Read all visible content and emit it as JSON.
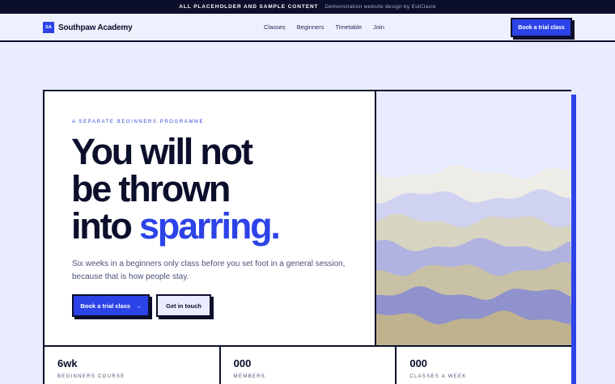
{
  "topbar": {
    "notice": "ALL PLACEHOLDER AND SAMPLE CONTENT",
    "credit": "Demonstration website design by EulClavie"
  },
  "header": {
    "logo_mark": "SA",
    "brand": "Southpaw Academy",
    "nav": [
      "Classes",
      "Beginners",
      "Timetable",
      "Join"
    ],
    "cta": "Book a trial class"
  },
  "hero": {
    "eyebrow": "A SEPARATE BEGINNERS PROGRAMME",
    "headline_line1": "You will not",
    "headline_line2": "be thrown",
    "headline_line3_start": "into",
    "headline_accent": "sparring.",
    "lede": "Six weeks in a beginners only class before you set foot in a general session, because that is how people stay.",
    "primary_button": "Book a trial class",
    "primary_arrow": "→",
    "secondary_button": "Get in touch",
    "art_colors": [
      "#eeece6",
      "#d0d2f1",
      "#d8d4c2",
      "#b0b3e0",
      "#c9c1a5",
      "#8f92cc",
      "#bfb28f"
    ]
  },
  "stats": [
    {
      "value": "6wk",
      "label": "BEGINNERS COURSE"
    },
    {
      "value": "000",
      "label": "MEMBERS"
    },
    {
      "value": "000",
      "label": "CLASSES A WEEK"
    }
  ],
  "colors": {
    "accent": "#2c43e8",
    "ink": "#0b0f2b",
    "page_bg": "#e8ecfd"
  }
}
